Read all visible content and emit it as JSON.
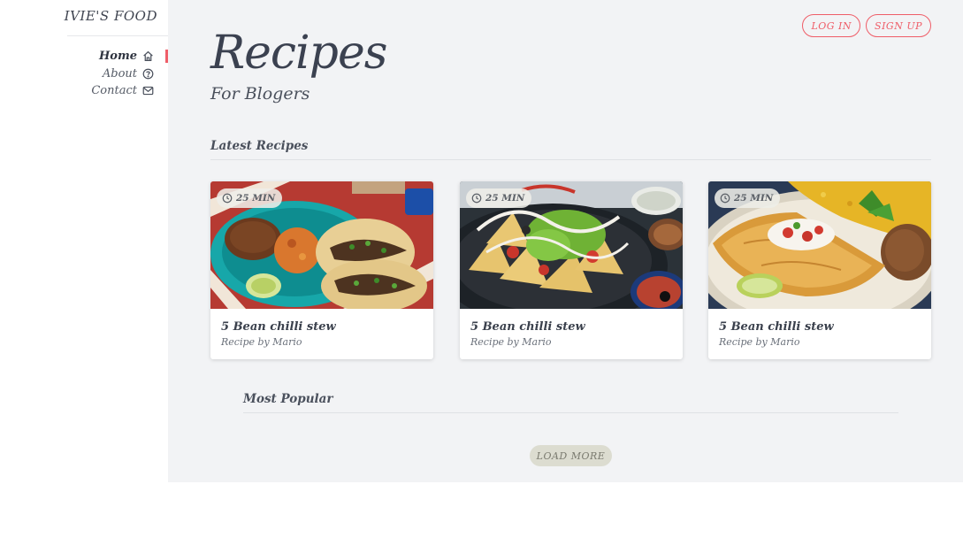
{
  "sidebar": {
    "brand": "IVIE'S FOOD",
    "items": [
      {
        "label": "Home",
        "icon": "home-icon",
        "active": true
      },
      {
        "label": "About",
        "icon": "question-circle-icon"
      },
      {
        "label": "Contact",
        "icon": "mail-icon"
      }
    ]
  },
  "header": {
    "login_label": "LOG IN",
    "signup_label": "SIGN UP"
  },
  "hero": {
    "title": "Recipes",
    "subtitle": "For Blogers"
  },
  "latest": {
    "title": "Latest Recipes",
    "cards": [
      {
        "time": "25 MIN",
        "title": "5 Bean chilli stew",
        "author": "Recipe by Mario"
      },
      {
        "time": "25 MIN",
        "title": "5 Bean chilli stew",
        "author": "Recipe by Mario"
      },
      {
        "time": "25 MIN",
        "title": "5 Bean chilli stew",
        "author": "Recipe by Mario"
      }
    ]
  },
  "popular": {
    "title": "Most Popular"
  },
  "load_more_label": "LOAD MORE",
  "colors": {
    "accent": "#ef5d68",
    "main_bg": "#f2f3f5",
    "text": "#3b4150"
  }
}
